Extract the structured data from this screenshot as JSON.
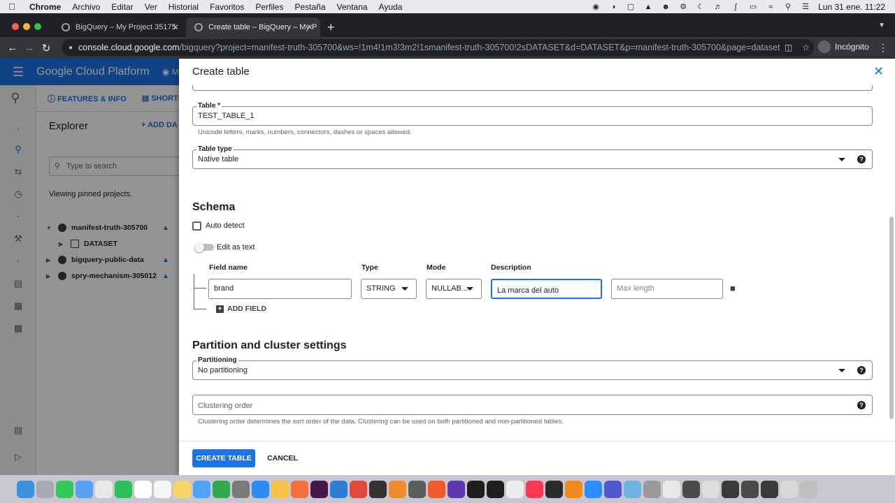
{
  "menubar": {
    "app": "Chrome",
    "items": [
      "Archivo",
      "Editar",
      "Ver",
      "Historial",
      "Favoritos",
      "Perfiles",
      "Pestaña",
      "Ventana",
      "Ayuda"
    ],
    "clock": "Lun 31 ene.  11:22"
  },
  "browser": {
    "tabs": [
      {
        "title": "BigQuery – My Project 35175"
      },
      {
        "title": "Create table – BigQuery – My P"
      }
    ],
    "url_host": "console.cloud.google.com",
    "url_path": "/bigquery?project=manifest-truth-305700&ws=!1m4!1m3!3m2!1smanifest-truth-305700!2sDATASET&d=DATASET&p=manifest-truth-305700&page=dataset",
    "profile": "Incógnito"
  },
  "gcp": {
    "brand": "Google Cloud Platform",
    "project_label": "My",
    "subnav": [
      "FEATURES & INFO",
      "SHORTCU"
    ],
    "explorer": {
      "title": "Explorer",
      "add_label": "ADD DA",
      "search_placeholder": "Type to search",
      "pinned_text": "Viewing pinned projects.",
      "tree": [
        {
          "label": "manifest-truth-305700"
        },
        {
          "label": "DATASET"
        },
        {
          "label": "bigquery-public-data"
        },
        {
          "label": "spry-mechanism-305012"
        }
      ]
    }
  },
  "panel": {
    "title": "Create table",
    "table_label": "Table *",
    "table_value": "TEST_TABLE_1",
    "table_hint": "Unicode letters, marks, numbers, connectors, dashes or spaces allowed.",
    "table_type_label": "Table type",
    "table_type_value": "Native table",
    "schema": {
      "title": "Schema",
      "auto_detect": "Auto detect",
      "auto_detect_checked": false,
      "edit_as_text": "Edit as text",
      "edit_as_text_on": false,
      "columns": [
        "Field name",
        "Type",
        "Mode",
        "Description"
      ],
      "field": {
        "name": "brand",
        "type": "STRING",
        "mode": "NULLAB...",
        "description": "La marca del auto",
        "max_length_placeholder": "Max length"
      },
      "add_field": "ADD FIELD"
    },
    "partition": {
      "title": "Partition and cluster settings",
      "partitioning_label": "Partitioning",
      "partitioning_value": "No partitioning",
      "clustering_placeholder": "Clustering order",
      "clustering_hint": "Clustering order determines the sort order of the data. Clustering can be used on both partitioned and non-partitioned tables."
    },
    "create_button": "CREATE TABLE",
    "cancel_button": "CANCEL"
  },
  "colors": {
    "accent": "#1a73e8",
    "header": "#1a73e8",
    "text": "#202124"
  }
}
